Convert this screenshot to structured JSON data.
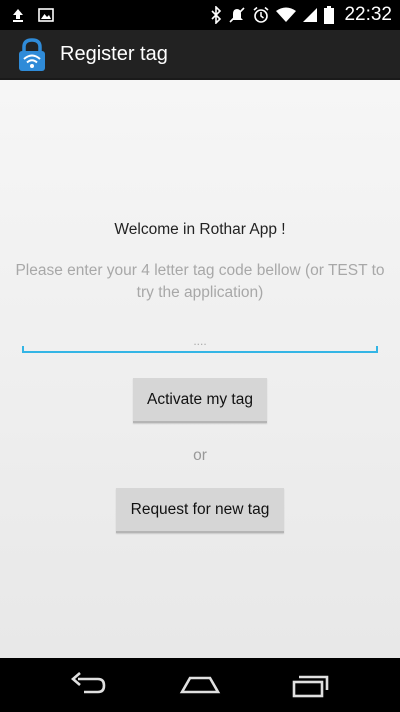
{
  "status_bar": {
    "time": "22:32",
    "icons": [
      "upload-icon",
      "image-icon",
      "bluetooth-icon",
      "mute-icon",
      "alarm-icon",
      "wifi-icon",
      "signal-icon",
      "battery-icon"
    ]
  },
  "action_bar": {
    "title": "Register tag",
    "icon": "lock-wifi-icon"
  },
  "main": {
    "welcome": "Welcome in Rothar App !",
    "instruction": "Please enter your 4 letter tag code bellow (or TEST to try the application)",
    "tag_input": {
      "value": "",
      "placeholder": "...."
    },
    "activate_button": "Activate my tag",
    "or_label": "or",
    "request_button": "Request for new tag"
  },
  "nav_bar": {
    "icons": [
      "back-icon",
      "home-icon",
      "recents-icon"
    ]
  },
  "colors": {
    "accent": "#33b5e5",
    "action_bar": "#222222",
    "app_icon": "#2f8bd8"
  }
}
